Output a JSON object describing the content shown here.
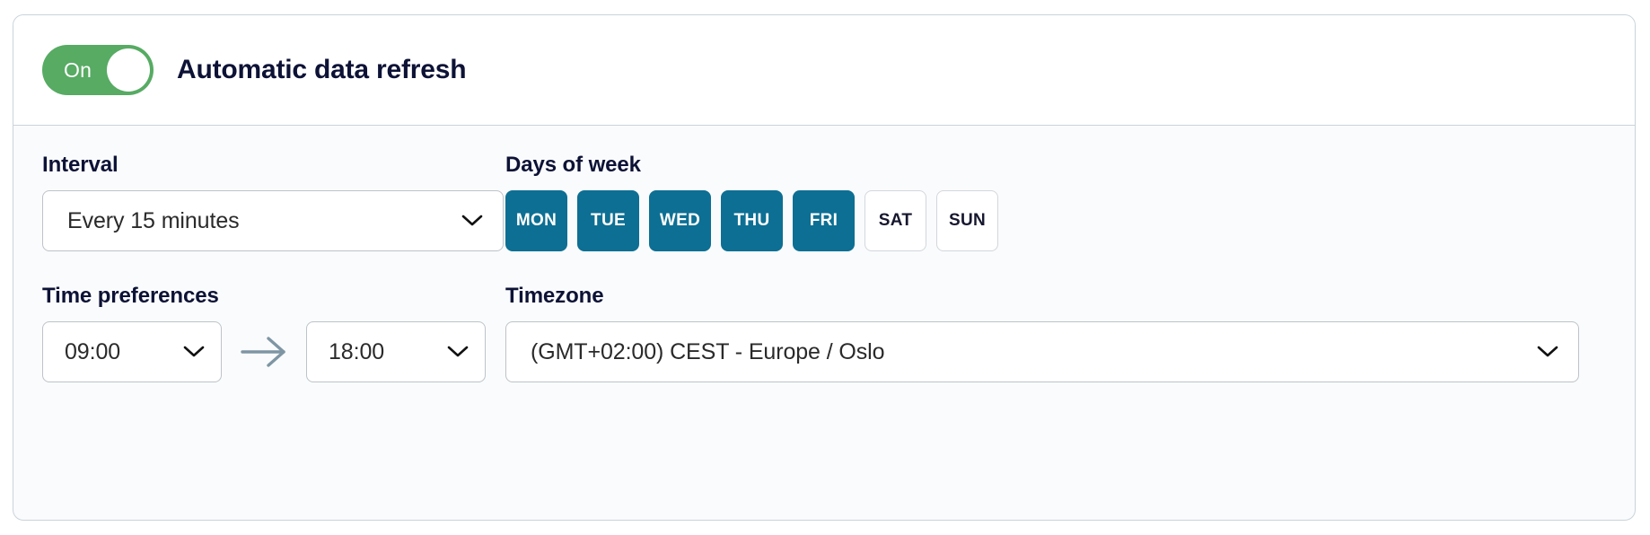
{
  "card": {
    "header": {
      "toggle": {
        "state_label": "On",
        "checked": true,
        "on_color": "#57ab63",
        "knob_color": "#ffffff"
      },
      "title": "Automatic data refresh"
    },
    "body": {
      "interval": {
        "label": "Interval",
        "value": "Every 15 minutes",
        "chevron_icon": "chevron-down-icon"
      },
      "days_of_week": {
        "label": "Days of week",
        "selected_color": "#0d6f93",
        "unselected_color": "#ffffff",
        "items": [
          {
            "label": "MON",
            "selected": true
          },
          {
            "label": "TUE",
            "selected": true
          },
          {
            "label": "WED",
            "selected": true
          },
          {
            "label": "THU",
            "selected": true
          },
          {
            "label": "FRI",
            "selected": true
          },
          {
            "label": "SAT",
            "selected": false
          },
          {
            "label": "SUN",
            "selected": false
          }
        ]
      },
      "time_preferences": {
        "label": "Time preferences",
        "start_value": "09:00",
        "end_value": "18:00",
        "arrow_icon": "arrow-right-icon",
        "arrow_color": "#7e96a4",
        "chevron_icon": "chevron-down-icon"
      },
      "timezone": {
        "label": "Timezone",
        "value": "(GMT+02:00) CEST - Europe / Oslo",
        "chevron_icon": "chevron-down-icon"
      }
    }
  }
}
